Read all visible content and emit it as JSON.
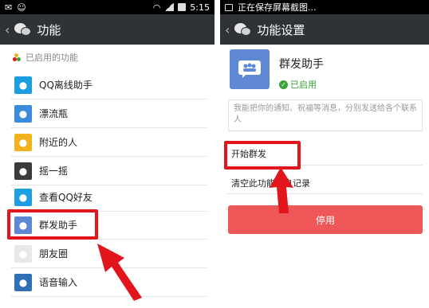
{
  "colors": {
    "highlight": "#e2141c",
    "appbar": "#2f3236",
    "accent": "#5f88d4",
    "enabled_green": "#3aa23a",
    "disable_button": "#ef5658"
  },
  "left": {
    "status": {
      "time": "5:15"
    },
    "title": "功能",
    "section_label": "已启用的功能",
    "items": [
      {
        "label": "QQ离线助手",
        "icon": "qq-offline-icon",
        "color": "#1d9ee0"
      },
      {
        "label": "漂流瓶",
        "icon": "drift-bottle-icon",
        "color": "#3a8bd9"
      },
      {
        "label": "附近的人",
        "icon": "location-pin-icon",
        "color": "#f2b21e"
      },
      {
        "label": "摇一摇",
        "icon": "shake-icon",
        "color": "#3b3b3b"
      },
      {
        "label": "查看QQ好友",
        "icon": "qq-friends-icon",
        "color": "#1d9ee0"
      },
      {
        "label": "群发助手",
        "icon": "mass-send-icon",
        "color": "#5f88d4"
      },
      {
        "label": "朋友圈",
        "icon": "moments-icon",
        "color": "#e8e8e8"
      },
      {
        "label": "语音输入",
        "icon": "voice-input-icon",
        "color": "#2f6fb5"
      }
    ]
  },
  "right": {
    "status": {
      "text": "正在保存屏幕截图..."
    },
    "title": "功能设置",
    "plugin_name": "群发助手",
    "status_label": "已启用",
    "description": "我能把你的通知、祝福等消息，分别发送给各个联系人",
    "start_label": "开始群发",
    "clear_label": "清空此功能消息记录",
    "disable_label": "停用"
  }
}
